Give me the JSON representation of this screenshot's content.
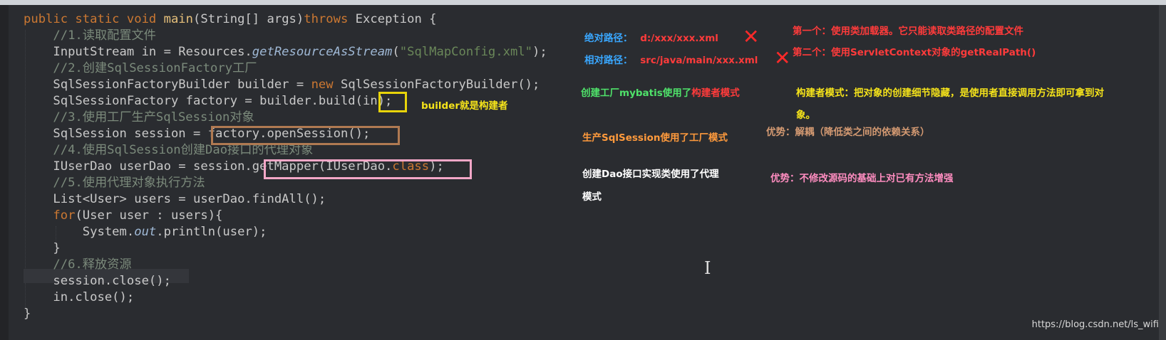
{
  "code": {
    "lines": [
      [
        {
          "c": "kw",
          "t": "public static void "
        },
        {
          "c": "fn",
          "t": "main"
        },
        {
          "c": "id",
          "t": "(String[] args)"
        },
        {
          "c": "kw",
          "t": "throws "
        },
        {
          "c": "id",
          "t": "Exception {"
        }
      ],
      [
        {
          "c": "cm",
          "t": "    //1.读取配置文件"
        }
      ],
      [
        {
          "c": "id",
          "t": "    InputStream in = Resources."
        },
        {
          "c": "it",
          "t": "getResourceAsStream"
        },
        {
          "c": "id",
          "t": "("
        },
        {
          "c": "str",
          "t": "\"SqlMapConfig.xml\""
        },
        {
          "c": "id",
          "t": ");"
        }
      ],
      [
        {
          "c": "cm",
          "t": "    //2.创建SqlSessionFactory工厂"
        }
      ],
      [
        {
          "c": "id",
          "t": "    SqlSessionFactoryBuilder builder = "
        },
        {
          "c": "kw",
          "t": "new "
        },
        {
          "c": "id",
          "t": "SqlSessionFactoryBuilder();"
        }
      ],
      [
        {
          "c": "id",
          "t": "    SqlSessionFactory factory = builder.build(in);"
        }
      ],
      [
        {
          "c": "cm",
          "t": "    //3.使用工厂生产SqlSession对象"
        }
      ],
      [
        {
          "c": "id",
          "t": "    SqlSession session = factory.openSession();"
        }
      ],
      [
        {
          "c": "cm",
          "t": "    //4.使用SqlSession创建Dao接口的代理对象"
        }
      ],
      [
        {
          "c": "id",
          "t": "    IUserDao userDao = session.getMapper(IUserDao."
        },
        {
          "c": "kw",
          "t": "class"
        },
        {
          "c": "id",
          "t": ");"
        }
      ],
      [
        {
          "c": "cm",
          "t": "    //5.使用代理对象执行方法"
        }
      ],
      [
        {
          "c": "id",
          "t": "    List<User> users = userDao.findAll();"
        }
      ],
      [
        {
          "c": "kw",
          "t": "    for"
        },
        {
          "c": "id",
          "t": "(User user : users){"
        }
      ],
      [
        {
          "c": "id",
          "t": "        System."
        },
        {
          "c": "it",
          "t": "out"
        },
        {
          "c": "id",
          "t": ".println(user);"
        }
      ],
      [
        {
          "c": "id",
          "t": "    }"
        }
      ],
      [
        {
          "c": "cm",
          "t": "    //6.释放资源"
        }
      ],
      [
        {
          "c": "id",
          "t": "    session.close();"
        }
      ],
      [
        {
          "c": "id",
          "t": "    in.close();"
        }
      ],
      [
        {
          "c": "id",
          "t": "}"
        }
      ]
    ]
  },
  "notes": {
    "abs_label": "绝对路径：",
    "abs_value": "d:/xxx/xxx.xml",
    "rel_label": "相对路径：",
    "rel_value": "src/java/main/xxx.xml",
    "cross_mark": "✕",
    "option1": "第一个：使用类加载器。它只能读取类路径的配置文件",
    "option2": "第二个：使用ServletContext对象的getRealPath()",
    "builder_note": "builder就是构建者",
    "factory_pre": "创建工厂mybatis使用了",
    "factory_pattern": "构建者模式",
    "builder_desc_1": "构建者模式：把对象的创建细节隐藏，是使用者直接调用方法即可拿到对",
    "builder_desc_2": "象。",
    "session_note": "生产SqlSession使用了工厂模式",
    "session_adv": "优势：解耦（降低类之间的依赖关系）",
    "dao_note_1": "创建Dao接口实现类使用了代理",
    "dao_note_2": "模式",
    "dao_adv": "优势：不修改源码的基础上对已有方法增强",
    "cursor": "I",
    "watermark": "https://blog.csdn.net/ls_wifi"
  },
  "colors": {
    "keyword": "#cc7832",
    "comment": "#7b8a7b",
    "string": "#6a8759",
    "annotation_blue": "#39a7ff",
    "annotation_red": "#ff3b3b",
    "annotation_green": "#4fe26a",
    "annotation_yellow": "#f5e31a",
    "highlight_in": "#e8d40a",
    "highlight_open": "#b07a52",
    "highlight_mapper": "#f3a7c7"
  }
}
